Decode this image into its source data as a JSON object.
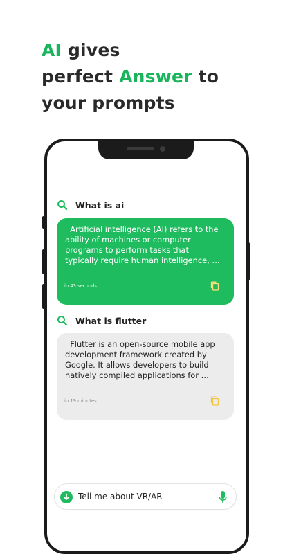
{
  "headline": {
    "line1_accent": "AI",
    "line1_rest": " gives",
    "line2_start": "perfect ",
    "line2_accent": "Answer",
    "line2_end": " to",
    "line3": "your prompts"
  },
  "chat": [
    {
      "query": "What is ai",
      "answer": "  Artificial intelligence (AI) refers to the ability of machines or computer programs to perform tasks that typically require human intelligence, such as learning, problem-solving, and decision-making. T...",
      "time": "in 43 seconds"
    },
    {
      "query": "What is flutter",
      "answer": "  Flutter is an open-source mobile app development framework created by Google. It allows developers to build natively compiled applications for mobile, web, and desktop from a single codebas...",
      "time": "in 19 minutes"
    }
  ],
  "input": {
    "value": "Tell me about VR/AR"
  },
  "colors": {
    "accent": "#1ebc5e",
    "copy_grey_card": "#f2c443"
  },
  "icons": [
    "search-icon",
    "copy-icon",
    "download-icon",
    "microphone-icon"
  ]
}
